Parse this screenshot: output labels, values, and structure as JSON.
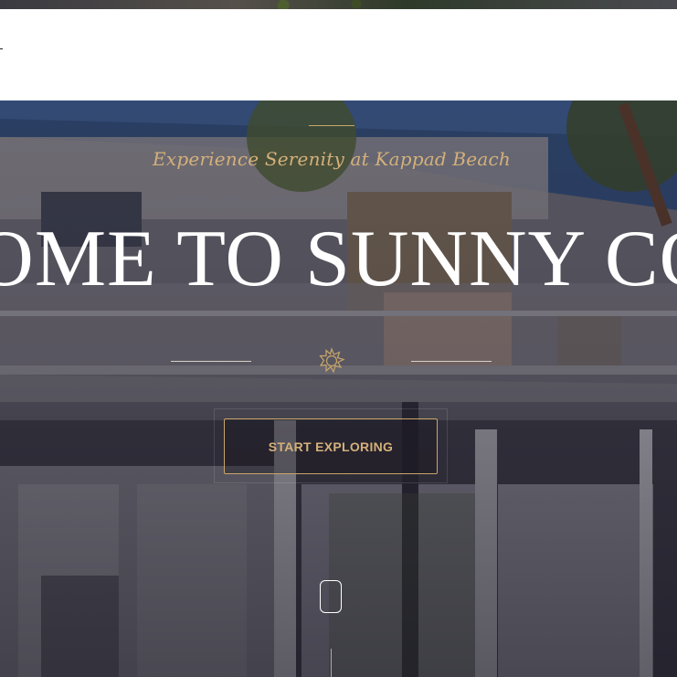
{
  "hero": {
    "tagline": "Experience Serenity at Kappad Beach",
    "title": "WELCOME TO SUNNY CORNER",
    "cta_label": "START EXPLORING"
  },
  "icons": {
    "divider": "sun-icon",
    "scroll": "mouse-scroll-icon"
  },
  "colors": {
    "accent_gold": "#c8a66a",
    "tagline_gold": "#d4b07a",
    "title": "#ffffff",
    "navbar_bg": "#ffffff"
  }
}
